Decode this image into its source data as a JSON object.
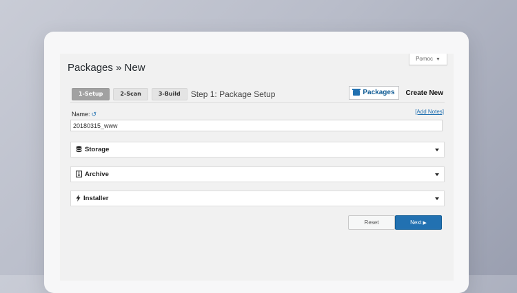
{
  "help_tab": {
    "label": "Pomoc",
    "caret": "▼"
  },
  "page": {
    "title": "Packages » New"
  },
  "steps": [
    {
      "label": "1-Setup",
      "active": true
    },
    {
      "label": "2-Scan",
      "active": false
    },
    {
      "label": "3-Build",
      "active": false
    }
  ],
  "step_heading": "Step 1: Package Setup",
  "header_actions": {
    "packages_label": "Packages",
    "create_new_label": "Create New"
  },
  "name_field": {
    "label": "Name:",
    "reset_icon": "undo-icon",
    "add_notes": "[Add Notes]",
    "value": "20180315_www"
  },
  "panels": [
    {
      "title": "Storage",
      "icon": "database-icon"
    },
    {
      "title": "Archive",
      "icon": "file-archive-icon"
    },
    {
      "title": "Installer",
      "icon": "bolt-icon"
    }
  ],
  "buttons": {
    "reset": "Reset",
    "next": "Next"
  },
  "colors": {
    "accent": "#2271b1",
    "step_active": "#a1a1a1"
  }
}
